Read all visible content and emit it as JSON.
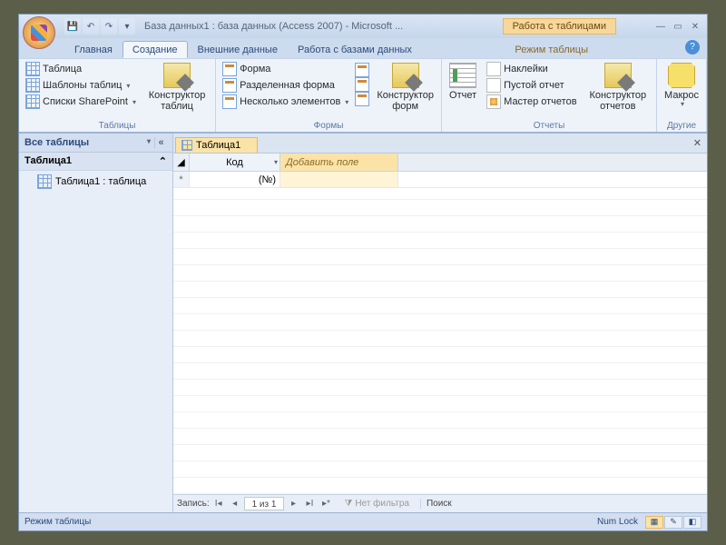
{
  "titlebar": {
    "title": "База данных1 : база данных (Access 2007) - Microsoft ...",
    "context_title": "Работа с таблицами"
  },
  "tabs": {
    "home": "Главная",
    "create": "Создание",
    "external": "Внешние данные",
    "dbtools": "Работа с базами данных",
    "datasheet": "Режим таблицы"
  },
  "ribbon": {
    "tables": {
      "label": "Таблицы",
      "table": "Таблица",
      "templates": "Шаблоны таблиц",
      "sharepoint": "Списки SharePoint",
      "designer": "Конструктор таблиц"
    },
    "forms": {
      "label": "Формы",
      "form": "Форма",
      "split": "Разделенная форма",
      "multi": "Несколько элементов",
      "designer": "Конструктор форм"
    },
    "reports": {
      "label": "Отчеты",
      "report": "Отчет",
      "labels": "Наклейки",
      "blank": "Пустой отчет",
      "wizard": "Мастер отчетов",
      "designer": "Конструктор отчетов"
    },
    "other": {
      "label": "Другие",
      "macro": "Макрос"
    }
  },
  "nav": {
    "header": "Все таблицы",
    "group": "Таблица1",
    "item": "Таблица1 : таблица"
  },
  "doc": {
    "tab": "Таблица1",
    "col_id": "Код",
    "col_add": "Добавить поле",
    "newrow_val": "(№)"
  },
  "recnav": {
    "label": "Запись:",
    "pos": "1 из 1",
    "filter": "Нет фильтра",
    "search": "Поиск"
  },
  "status": {
    "mode": "Режим таблицы",
    "numlock": "Num Lock"
  }
}
